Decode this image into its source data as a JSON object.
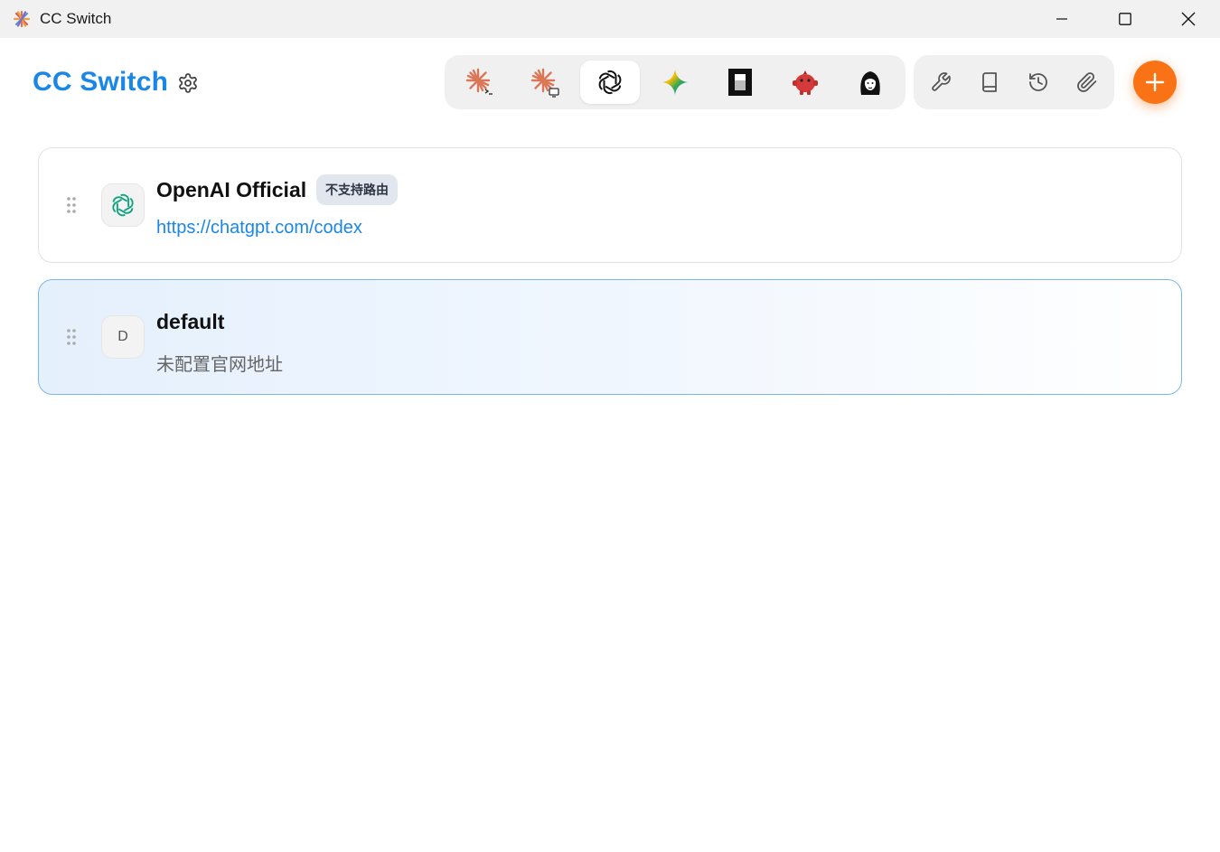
{
  "window": {
    "title": "CC Switch",
    "controls": [
      "minimize",
      "maximize",
      "close"
    ]
  },
  "header": {
    "brand": "CC Switch",
    "settings_icon": "gear-icon"
  },
  "app_switcher": {
    "tabs": [
      {
        "name": "claude-code",
        "icon": "claude-terminal-icon",
        "active": false
      },
      {
        "name": "claude-desktop",
        "icon": "claude-desktop-icon",
        "active": false
      },
      {
        "name": "codex",
        "icon": "openai-icon",
        "active": true
      },
      {
        "name": "gemini",
        "icon": "gemini-icon",
        "active": false
      },
      {
        "name": "opencode",
        "icon": "opencode-icon",
        "active": false
      },
      {
        "name": "red-creature",
        "icon": "red-creature-icon",
        "active": false
      },
      {
        "name": "portrait",
        "icon": "portrait-icon",
        "active": false
      }
    ]
  },
  "tools": [
    {
      "icon": "wrench-icon"
    },
    {
      "icon": "book-icon"
    },
    {
      "icon": "history-icon"
    },
    {
      "icon": "paperclip-icon"
    }
  ],
  "add_button": {
    "icon": "plus-icon",
    "color": "#f97316"
  },
  "providers": [
    {
      "name": "OpenAI Official",
      "badge": "不支持路由",
      "url": "https://chatgpt.com/codex",
      "icon": "openai-icon",
      "active": false
    },
    {
      "name": "default",
      "initial": "D",
      "subtitle": "未配置官网地址",
      "active": true
    }
  ],
  "colors": {
    "brand": "#1a86e6",
    "accent": "#f97316",
    "active_border": "#7ab8ea"
  }
}
